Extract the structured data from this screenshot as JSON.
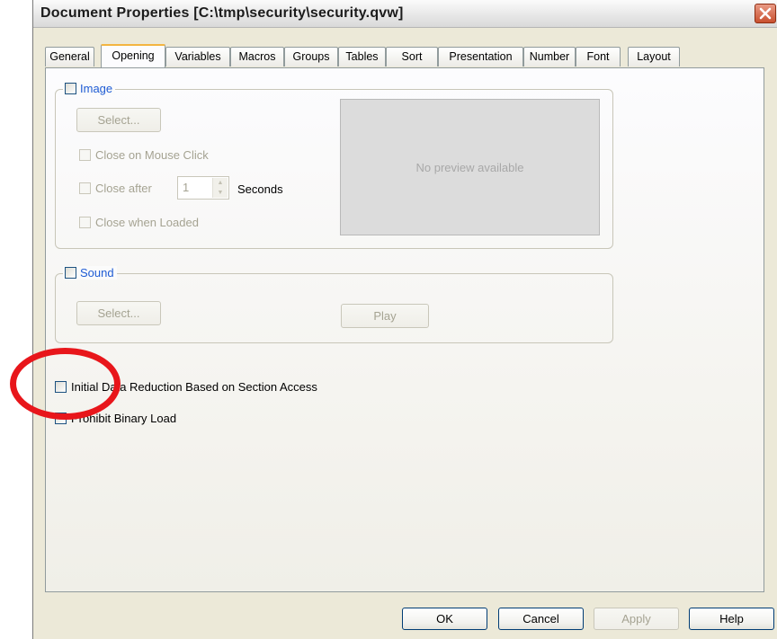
{
  "window": {
    "title": "Document Properties [C:\\tmp\\security\\security.qvw]",
    "close_icon": "close-icon",
    "close_color": "#c9502f"
  },
  "tabs": [
    {
      "label": "General"
    },
    {
      "label": "Opening",
      "active": true
    },
    {
      "label": "Variables"
    },
    {
      "label": "Macros"
    },
    {
      "label": "Groups"
    },
    {
      "label": "Tables"
    },
    {
      "label": "Sort"
    },
    {
      "label": "Presentation"
    },
    {
      "label": "Number"
    },
    {
      "label": "Font"
    },
    {
      "label": "Layout"
    }
  ],
  "image_group": {
    "checkbox_label": "Image",
    "checked": false,
    "select_button": "Select...",
    "close_on_mouse_click": "Close on Mouse Click",
    "close_after": "Close after",
    "close_after_value": "1",
    "seconds_label": "Seconds",
    "close_when_loaded": "Close when Loaded",
    "preview_text": "No preview available"
  },
  "sound_group": {
    "checkbox_label": "Sound",
    "checked": false,
    "select_button": "Select...",
    "play_button": "Play"
  },
  "options": {
    "initial_data_reduction": "Initial Data Reduction Based on Section Access",
    "initial_data_reduction_checked": false,
    "prohibit_binary_load": "Prohibit Binary Load",
    "prohibit_binary_load_checked": false
  },
  "footer": {
    "ok": "OK",
    "cancel": "Cancel",
    "apply": "Apply",
    "help": "Help"
  },
  "annotation": {
    "highlight_color": "#e8161b"
  }
}
